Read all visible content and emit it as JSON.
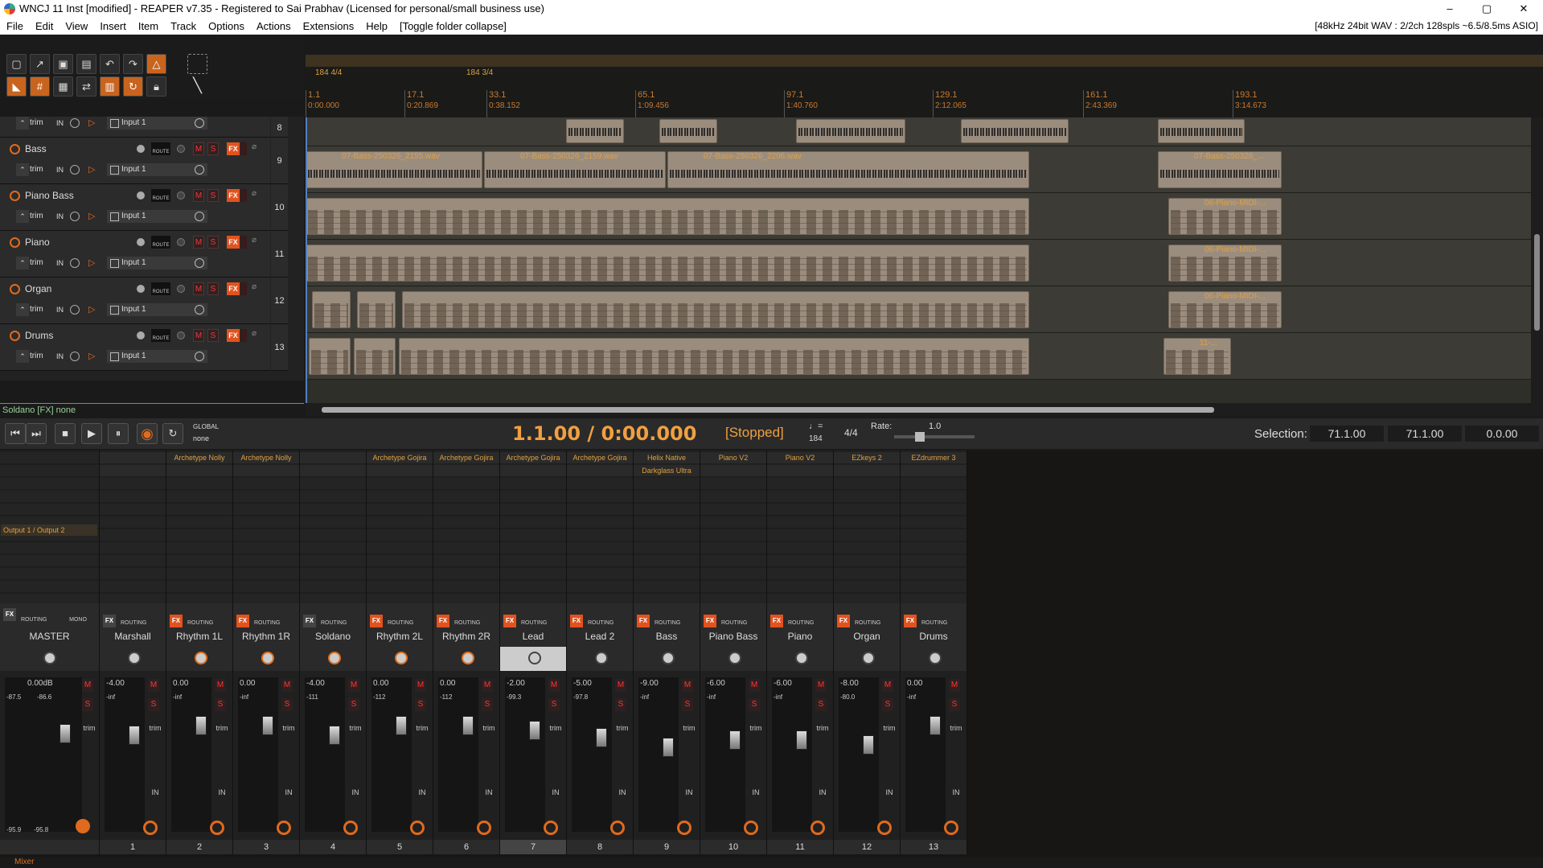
{
  "window": {
    "title": "WNCJ 11 Inst [modified] - REAPER v7.35 - Registered to Sai Prabhav (Licensed for personal/small business use)",
    "minimize": "–",
    "maximize": "▢",
    "close": "✕"
  },
  "menu": {
    "items": [
      "File",
      "Edit",
      "View",
      "Insert",
      "Item",
      "Track",
      "Options",
      "Actions",
      "Extensions",
      "Help",
      "[Toggle folder collapse]"
    ],
    "status": "[48kHz 24bit WAV : 2/2ch 128spls ~6.5/8.5ms ASIO]"
  },
  "timeline": {
    "ts1": "184 4/4",
    "ts2": "184 3/4",
    "marks": [
      {
        "bar": "1.1",
        "time": "0:00.000"
      },
      {
        "bar": "17.1",
        "time": "0:20.869"
      },
      {
        "bar": "33.1",
        "time": "0:38.152"
      },
      {
        "bar": "65.1",
        "time": "1:09.456"
      },
      {
        "bar": "97.1",
        "time": "1:40.760"
      },
      {
        "bar": "129.1",
        "time": "2:12.065"
      },
      {
        "bar": "161.1",
        "time": "2:43.369"
      },
      {
        "bar": "193.1",
        "time": "3:14.673"
      }
    ]
  },
  "tracks": [
    {
      "name": "Bass",
      "num": "9",
      "trim": "trim",
      "in": "IN",
      "input": "Input 1"
    },
    {
      "name": "Piano Bass",
      "num": "10",
      "trim": "trim",
      "in": "IN",
      "input": "Input 1"
    },
    {
      "name": "Piano",
      "num": "11",
      "trim": "trim",
      "in": "IN",
      "input": "Input 1"
    },
    {
      "name": "Organ",
      "num": "12",
      "trim": "trim",
      "in": "IN",
      "input": "Input 1"
    },
    {
      "name": "Drums",
      "num": "13",
      "trim": "trim",
      "in": "IN",
      "input": "Input 1"
    }
  ],
  "track8": {
    "num": "8",
    "trim": "trim",
    "in": "IN",
    "input": "Input 1"
  },
  "trackButtons": {
    "route": "ROUTE",
    "m": "M",
    "s": "S",
    "fx": "FX"
  },
  "itemLabels": {
    "bass1": "07-Bass-250326_2155.wav",
    "bass2": "07-Bass-250326_2159.wav",
    "bass3": "07-Bass-250326_2206.wav",
    "bass4": "07-Bass-250326_...",
    "pianobass": "06-Piano-MIDI-...",
    "piano": "06-Piano-MIDI-...",
    "organ": "06-Piano-MIDI-...",
    "drums": "11-..."
  },
  "statusline": "Soldano [FX] none",
  "transport": {
    "time": "1.1.00 / 0:00.000",
    "state": "[Stopped]",
    "tempo": "184",
    "timesig": "4/4",
    "rate_label": "Rate:",
    "rate": "1.0",
    "global": "GLOBAL",
    "global_sub": "none",
    "selection_label": "Selection:",
    "sel_start": "71.1.00",
    "sel_end": "71.1.00",
    "sel_len": "0.0.00"
  },
  "mixer": {
    "master": {
      "name": "MASTER",
      "db": "0.00dB",
      "output": "Output 1 / Output 2",
      "routing": "ROUTING",
      "mono": "MONO",
      "peakL": "-87.5",
      "peakR": "-86.6",
      "minL": "-95.9",
      "minR": "-95.8"
    },
    "strips": [
      {
        "name": "Marshall",
        "num": "1",
        "fx1": "",
        "fx2": "",
        "db": "-4.00",
        "peak": "-inf",
        "fxOn": false
      },
      {
        "name": "Rhythm 1L",
        "num": "2",
        "fx1": "Archetype Nolly",
        "fx2": "",
        "db": "0.00",
        "peak": "-inf",
        "fxOn": true
      },
      {
        "name": "Rhythm 1R",
        "num": "3",
        "fx1": "Archetype Nolly",
        "fx2": "",
        "db": "0.00",
        "peak": "-inf",
        "fxOn": true
      },
      {
        "name": "Soldano",
        "num": "4",
        "fx1": "",
        "fx2": "",
        "db": "-4.00",
        "peak": "-111",
        "fxOn": false
      },
      {
        "name": "Rhythm 2L",
        "num": "5",
        "fx1": "Archetype Gojira",
        "fx2": "",
        "db": "0.00",
        "peak": "-112",
        "fxOn": true
      },
      {
        "name": "Rhythm 2R",
        "num": "6",
        "fx1": "Archetype Gojira",
        "fx2": "",
        "db": "0.00",
        "peak": "-112",
        "fxOn": true
      },
      {
        "name": "Lead",
        "num": "7",
        "fx1": "Archetype Gojira",
        "fx2": "",
        "db": "-2.00",
        "peak": "-99.3",
        "fxOn": true
      },
      {
        "name": "Lead 2",
        "num": "8",
        "fx1": "Archetype Gojira",
        "fx2": "",
        "db": "-5.00",
        "peak": "-97.8",
        "fxOn": true
      },
      {
        "name": "Bass",
        "num": "9",
        "fx1": "Helix Native",
        "fx2": "Darkglass Ultra",
        "db": "-9.00",
        "peak": "-inf",
        "fxOn": true
      },
      {
        "name": "Piano Bass",
        "num": "10",
        "fx1": "Piano V2",
        "fx2": "",
        "db": "-6.00",
        "peak": "-inf",
        "fxOn": true
      },
      {
        "name": "Piano",
        "num": "11",
        "fx1": "Piano V2",
        "fx2": "",
        "db": "-6.00",
        "peak": "-inf",
        "fxOn": true
      },
      {
        "name": "Organ",
        "num": "12",
        "fx1": "EZkeys 2",
        "fx2": "",
        "db": "-8.00",
        "peak": "-80.0",
        "fxOn": true
      },
      {
        "name": "Drums",
        "num": "13",
        "fx1": "EZdrummer 3",
        "fx2": "",
        "db": "0.00",
        "peak": "-inf",
        "fxOn": true
      }
    ],
    "labels": {
      "fx": "FX",
      "routing": "ROUTING",
      "m": "M",
      "s": "S",
      "trim": "trim",
      "in": "IN"
    }
  },
  "mixerTab": "Mixer"
}
